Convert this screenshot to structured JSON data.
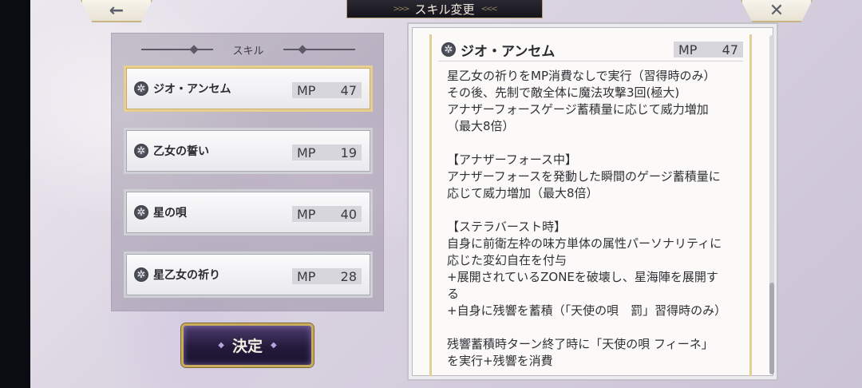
{
  "title": "スキル変更",
  "nav": {
    "back_icon": "←",
    "close_icon": "✕"
  },
  "skill_panel": {
    "header": "スキル",
    "items": [
      {
        "name": "ジオ・アンセム",
        "mp_label": "MP",
        "mp": "47",
        "selected": true
      },
      {
        "name": "乙女の誓い",
        "mp_label": "MP",
        "mp": "19",
        "selected": false
      },
      {
        "name": "星の唄",
        "mp_label": "MP",
        "mp": "40",
        "selected": false
      },
      {
        "name": "星乙女の祈り",
        "mp_label": "MP",
        "mp": "28",
        "selected": false
      }
    ]
  },
  "confirm_label": "決定",
  "detail": {
    "name": "ジオ・アンセム",
    "mp_label": "MP",
    "mp": "47",
    "lines": [
      "星乙女の祈りをMP消費なしで実行（習得時のみ）",
      "その後、先制で敵全体に魔法攻撃3回(極大)",
      "アナザーフォースゲージ蓄積量に応じて威力増加",
      "（最大8倍）",
      "",
      "【アナザーフォース中】",
      "アナザーフォースを発動した瞬間のゲージ蓄積量に",
      "応じて威力増加（最大8倍）",
      "",
      "【ステラバースト時】",
      "自身に前衛左枠の味方単体の属性パーソナリティに",
      "応じた変幻自在を付与",
      "+展開されているZONEを破壊し、星海陣を展開す",
      "る",
      "+自身に残響を蓄積（「天使の唄　罰」習得時のみ）",
      "",
      "残響蓄積時ターン終了時に「天使の唄 フィーネ」",
      "を実行+残響を消費"
    ]
  },
  "icons": {
    "skill_icon": "skill-emblem-icon",
    "skill_icon_glyph": "✲"
  },
  "colors": {
    "selected_border": "#e6cf8f",
    "confirm_border": "#c9ac5c"
  }
}
